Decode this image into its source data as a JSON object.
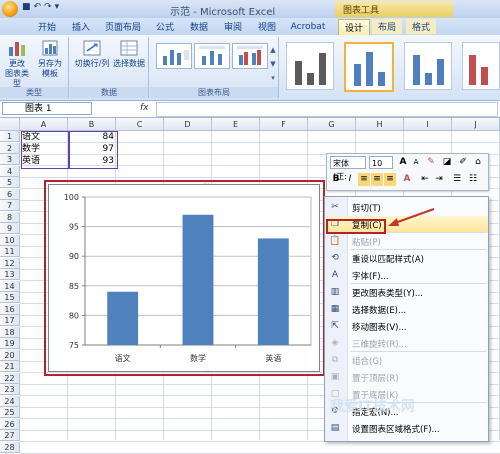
{
  "window": {
    "title": "示范 - Microsoft Excel",
    "context_tools": "图表工具"
  },
  "tabs": [
    {
      "label": "开始"
    },
    {
      "label": "插入"
    },
    {
      "label": "页面布局"
    },
    {
      "label": "公式"
    },
    {
      "label": "数据"
    },
    {
      "label": "审阅"
    },
    {
      "label": "视图"
    },
    {
      "label": "Acrobat"
    },
    {
      "label": "设计"
    },
    {
      "label": "布局"
    },
    {
      "label": "格式"
    }
  ],
  "ribbon": {
    "type_group": {
      "label": "类型",
      "change_type": "更改\n图表类型",
      "save_template": "另存为\n模板"
    },
    "data_group": {
      "label": "数据",
      "switch_row_col": "切换行/列",
      "select_data": "选择数据"
    },
    "layout_group": {
      "label": "图表布局"
    },
    "style_colors": {
      "bar_dark": "#5b5b5b",
      "bar_blue": "#4f7fbf",
      "bar_red": "#c0504d",
      "selected_border": "#f2b23c"
    }
  },
  "formula_bar": {
    "name_box": "图表 1",
    "fx": "fx",
    "value": ""
  },
  "sheet": {
    "columns": [
      "A",
      "B",
      "C",
      "D",
      "E",
      "F",
      "G",
      "H",
      "I",
      "J"
    ],
    "rows": [
      "1",
      "2",
      "3",
      "4",
      "5",
      "6",
      "7",
      "8",
      "9",
      "10",
      "11",
      "12",
      "13",
      "14",
      "15",
      "16",
      "17",
      "18",
      "19",
      "20",
      "21",
      "22",
      "23",
      "24",
      "25",
      "26",
      "27",
      "28"
    ],
    "cells": [
      {
        "label": "语文",
        "value": "84"
      },
      {
        "label": "数学",
        "value": "97"
      },
      {
        "label": "英语",
        "value": "93"
      }
    ]
  },
  "chart_data": {
    "type": "bar",
    "categories": [
      "语文",
      "数学",
      "英语"
    ],
    "values": [
      84,
      97,
      93
    ],
    "title": "",
    "xlabel": "",
    "ylabel": "",
    "ylim": [
      75,
      100
    ],
    "yticks": [
      75,
      80,
      85,
      90,
      95,
      100
    ],
    "grid": true,
    "legend": "none",
    "bar_color": "#4f81bd"
  },
  "mini_toolbar": {
    "font": "宋体 (正:",
    "size": "10",
    "grow": "A",
    "shrink": "A",
    "bold": "B",
    "italic": "I",
    "font_color_letter": "A"
  },
  "context_menu": {
    "items": [
      {
        "label": "剪切(T)",
        "icon": "scissors-icon",
        "disabled": false
      },
      {
        "label": "复制(C)",
        "icon": "copy-icon",
        "disabled": false,
        "highlighted": true
      },
      {
        "label": "粘贴(P)",
        "icon": "paste-icon",
        "disabled": true
      },
      {
        "label": "重设以匹配样式(A)",
        "icon": "reset-style-icon",
        "disabled": false
      },
      {
        "label": "字体(F)...",
        "icon": "font-icon",
        "disabled": false
      },
      {
        "label": "更改图表类型(Y)...",
        "icon": "chart-type-icon",
        "disabled": false
      },
      {
        "label": "选择数据(E)...",
        "icon": "select-data-icon",
        "disabled": false
      },
      {
        "label": "移动图表(V)...",
        "icon": "move-chart-icon",
        "disabled": false
      },
      {
        "label": "三维旋转(R)...",
        "icon": "rotate-3d-icon",
        "disabled": true
      },
      {
        "label": "组合(G)",
        "icon": "group-icon",
        "disabled": true
      },
      {
        "label": "置于顶层(R)",
        "icon": "bring-front-icon",
        "disabled": true
      },
      {
        "label": "置于底层(K)",
        "icon": "send-back-icon",
        "disabled": true
      },
      {
        "label": "指定宏(N)...",
        "icon": "macro-icon",
        "disabled": false
      },
      {
        "label": "设置图表区域格式(F)...",
        "icon": "format-area-icon",
        "disabled": false
      }
    ]
  },
  "annotation_color": "#b3232b",
  "watermark": "我爱IT技术网"
}
